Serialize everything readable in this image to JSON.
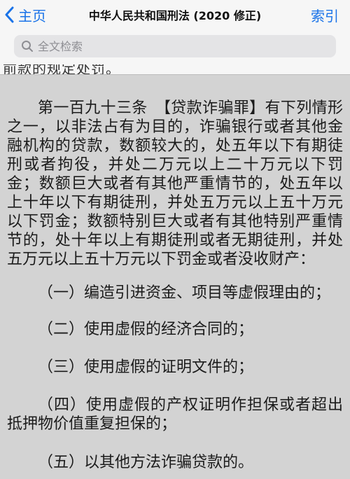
{
  "navbar": {
    "back_label": "主页",
    "title": "中华人民共和国刑法 (2020 修正)",
    "index_label": "索引"
  },
  "search": {
    "placeholder": "全文检索"
  },
  "peek_text": "前款的规定处罚。",
  "article": {
    "number": "第一百九十三条",
    "heading": "【贷款诈骗罪】",
    "body": "有下列情形之一，以非法占有为目的，诈骗银行或者其他金融机构的贷款，数额较大的，处五年以下有期徒刑或者拘役，并处二万元以上二十万元以下罚金；数额巨大或者有其他严重情节的，处五年以上十年以下有期徒刑，并处五万元以上五十万元以下罚金；数额特别巨大或者有其他特别严重情节的，处十年以上有期徒刑或者无期徒刑，并处五万元以上五十万元以下罚金或者没收财产："
  },
  "clauses": [
    "（一）编造引进资金、项目等虚假理由的；",
    "（二）使用虚假的经济合同的；",
    "（三）使用虚假的证明文件的；",
    "（四）使用虚假的产权证明作担保或者超出抵押物价值重复担保的；",
    "（五）以其他方法诈骗贷款的。"
  ],
  "colors": {
    "accent": "#1a73e8",
    "content_bg": "#d3d3d3",
    "bar_bg": "#f6f6f6"
  },
  "icons": {
    "back": "chevron-left-icon",
    "search": "search-icon"
  }
}
